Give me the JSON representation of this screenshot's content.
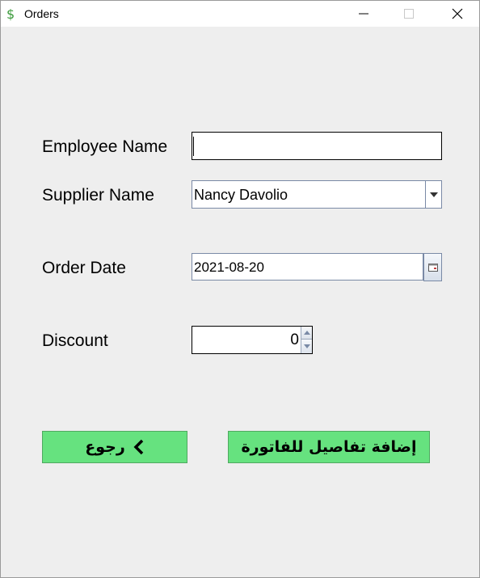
{
  "window": {
    "title": "Orders",
    "icon": "dollar-sign-icon"
  },
  "form": {
    "employee_label": "Employee Name",
    "employee_value": "",
    "supplier_label": "Supplier Name",
    "supplier_selected": "Nancy Davolio",
    "order_date_label": "Order Date",
    "order_date_value": "2021-08-20",
    "discount_label": "Discount",
    "discount_value": "0"
  },
  "buttons": {
    "back_label": "رجوع",
    "add_details_label": "إضافة تفاصيل للفاتورة"
  },
  "colors": {
    "button_green": "#66e27f",
    "background": "#eeeeee"
  }
}
